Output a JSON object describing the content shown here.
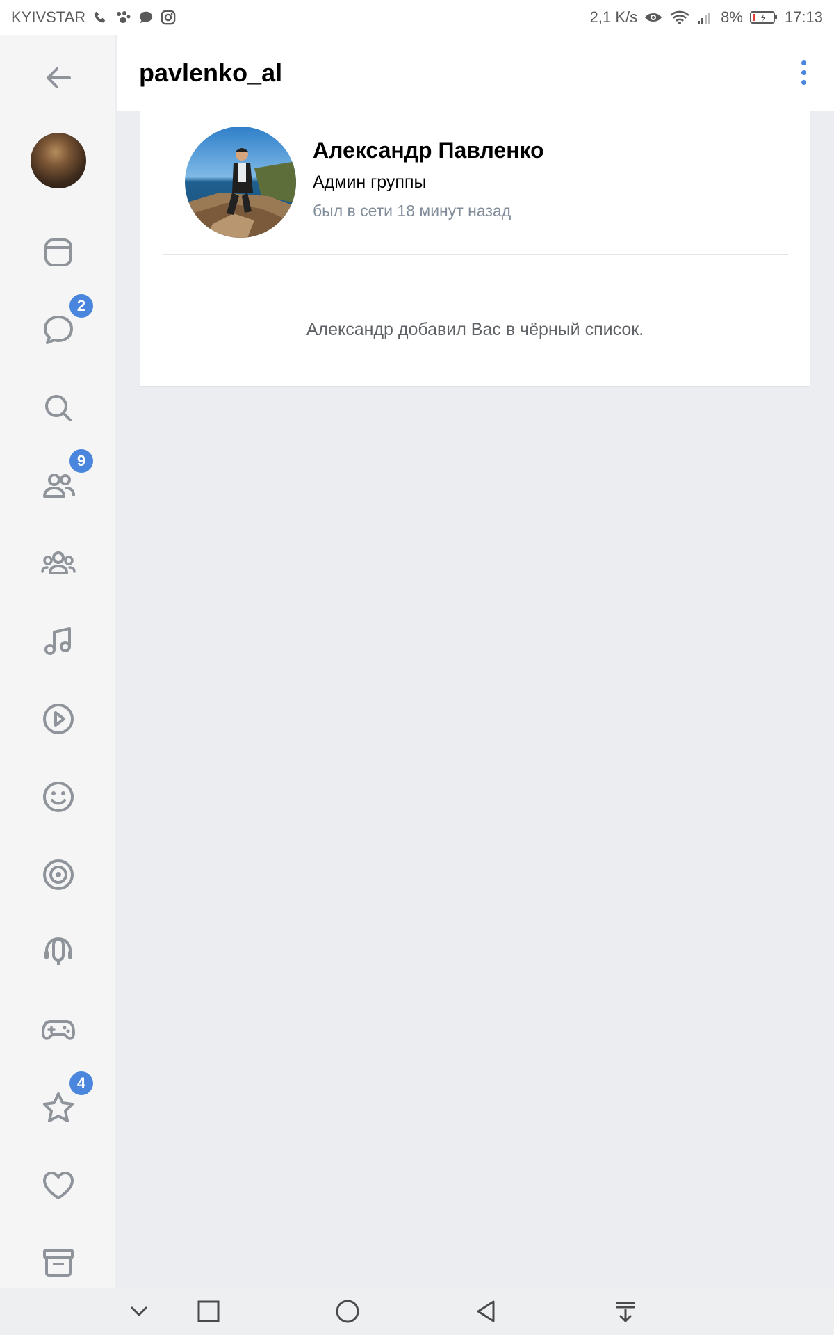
{
  "status_bar": {
    "carrier": "KYIVSTAR",
    "network_speed": "2,1 K/s",
    "battery": "8%",
    "time": "17:13"
  },
  "header": {
    "title": "pavlenko_al"
  },
  "sidebar": {
    "items": [
      {
        "name": "back",
        "icon": "arrow-left-icon"
      },
      {
        "name": "profile",
        "icon": "avatar"
      },
      {
        "name": "news",
        "icon": "newsfeed-icon"
      },
      {
        "name": "messages",
        "icon": "message-icon",
        "badge": "2"
      },
      {
        "name": "search",
        "icon": "search-icon"
      },
      {
        "name": "friends",
        "icon": "friends-icon",
        "badge": "9"
      },
      {
        "name": "communities",
        "icon": "communities-icon"
      },
      {
        "name": "music",
        "icon": "music-icon"
      },
      {
        "name": "video",
        "icon": "play-icon"
      },
      {
        "name": "stickers",
        "icon": "smile-icon"
      },
      {
        "name": "stories",
        "icon": "target-icon"
      },
      {
        "name": "podcasts",
        "icon": "podcast-icon"
      },
      {
        "name": "games",
        "icon": "gamepad-icon"
      },
      {
        "name": "favorites",
        "icon": "star-icon",
        "badge": "4"
      },
      {
        "name": "likes",
        "icon": "heart-icon"
      },
      {
        "name": "archive",
        "icon": "archive-icon"
      }
    ]
  },
  "profile": {
    "name": "Александр Павленко",
    "role": "Админ группы",
    "last_seen": "был в сети 18 минут назад",
    "notice": "Александр добавил Вас в чёрный список."
  },
  "colors": {
    "accent": "#4a86dd",
    "background": "#ebedf0",
    "secondary_text": "#818c99"
  }
}
